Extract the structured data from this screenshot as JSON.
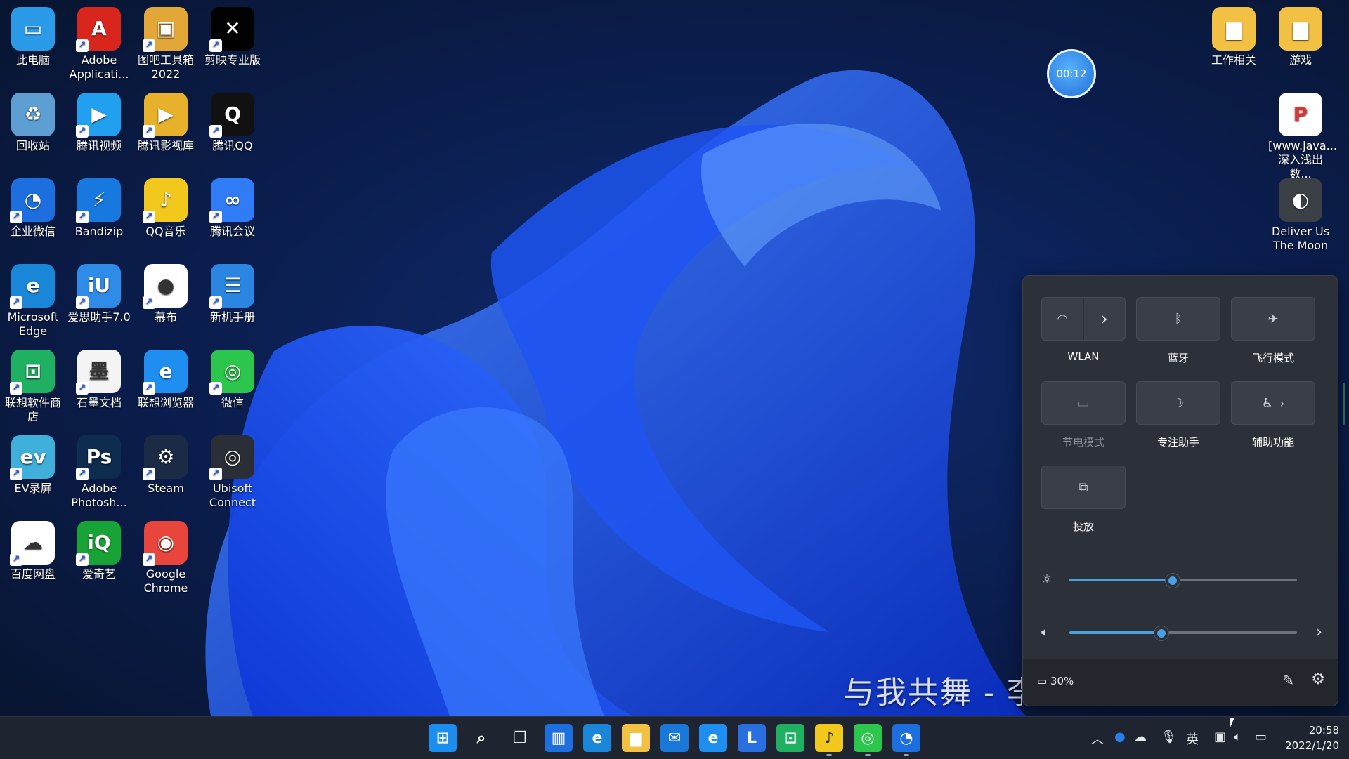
{
  "desktop": {
    "icons": [
      {
        "label": "此电脑",
        "icon": "computer-icon",
        "color": "#2b9be8",
        "glyph": "▭"
      },
      {
        "label": "Adobe Applicati...",
        "icon": "adobe-icon",
        "color": "#d9261c",
        "glyph": "A"
      },
      {
        "label": "图吧工具箱 2022",
        "icon": "toolbox-icon",
        "color": "#e2a736",
        "glyph": "▣"
      },
      {
        "label": "剪映专业版",
        "icon": "capcut-icon",
        "color": "#000000",
        "glyph": "✕"
      },
      {
        "label": "回收站",
        "icon": "recycle-bin-icon",
        "color": "#5d9fd3",
        "glyph": "♻"
      },
      {
        "label": "腾讯视频",
        "icon": "tencent-video-icon",
        "color": "#21a0f0",
        "glyph": "▶"
      },
      {
        "label": "腾讯影视库",
        "icon": "video-library-icon",
        "color": "#e7b12b",
        "glyph": "▶"
      },
      {
        "label": "腾讯QQ",
        "icon": "qq-icon",
        "color": "#111111",
        "glyph": "Q"
      },
      {
        "label": "企业微信",
        "icon": "wecom-icon",
        "color": "#1d6fe0",
        "glyph": "◔"
      },
      {
        "label": "Bandizip",
        "icon": "bandizip-icon",
        "color": "#1779e0",
        "glyph": "⚡"
      },
      {
        "label": "QQ音乐",
        "icon": "qq-music-icon",
        "color": "#f2c81d",
        "glyph": "♪"
      },
      {
        "label": "腾讯会议",
        "icon": "tencent-meeting-icon",
        "color": "#2f7cf6",
        "glyph": "∞"
      },
      {
        "label": "Microsoft Edge",
        "icon": "edge-icon",
        "color": "#1a86d8",
        "glyph": "e"
      },
      {
        "label": "爱思助手7.0",
        "icon": "i4-icon",
        "color": "#2e8be8",
        "glyph": "iU"
      },
      {
        "label": "幕布",
        "icon": "mubu-icon",
        "color": "#ffffff",
        "glyph": "●"
      },
      {
        "label": "新机手册",
        "icon": "manual-icon",
        "color": "#2a86e0",
        "glyph": "☰"
      },
      {
        "label": "联想软件商店",
        "icon": "lenovo-store-icon",
        "color": "#20b062",
        "glyph": "⊡"
      },
      {
        "label": "石墨文档",
        "icon": "shimo-icon",
        "color": "#f4f4f4",
        "glyph": "墨"
      },
      {
        "label": "联想浏览器",
        "icon": "lenovo-browser-icon",
        "color": "#1e8ff0",
        "glyph": "e"
      },
      {
        "label": "微信",
        "icon": "wechat-icon",
        "color": "#2cc64d",
        "glyph": "◎"
      },
      {
        "label": "EV录屏",
        "icon": "ev-recorder-icon",
        "color": "#3fb0d9",
        "glyph": "ev"
      },
      {
        "label": "Adobe Photosh...",
        "icon": "photoshop-icon",
        "color": "#0d2c4f",
        "glyph": "Ps"
      },
      {
        "label": "Steam",
        "icon": "steam-icon",
        "color": "#1b2b45",
        "glyph": "⚙"
      },
      {
        "label": "Ubisoft Connect",
        "icon": "ubisoft-icon",
        "color": "#2a2e36",
        "glyph": "◎"
      },
      {
        "label": "百度网盘",
        "icon": "baidu-netdisk-icon",
        "color": "#ffffff",
        "glyph": "☁"
      },
      {
        "label": "爱奇艺",
        "icon": "iqiyi-icon",
        "color": "#18a336",
        "glyph": "iQ"
      },
      {
        "label": "Google Chrome",
        "icon": "chrome-icon",
        "color": "#e8453c",
        "glyph": "◉"
      }
    ],
    "right_icons": [
      {
        "label": "工作相关",
        "icon": "folder-icon",
        "color": "#f2c144",
        "glyph": "▆"
      },
      {
        "label": "游戏",
        "icon": "folder-icon",
        "color": "#f2c144",
        "glyph": "▆"
      },
      {
        "label": "[www.java... 深入浅出数...",
        "icon": "pdf-icon",
        "color": "#ffffff",
        "glyph": "P"
      },
      {
        "label": "Deliver Us The Moon",
        "icon": "game-icon",
        "color": "#3b3f46",
        "glyph": "◐"
      }
    ],
    "timer": "00:12",
    "lyrics": "与我共舞 - 李"
  },
  "quick_settings": {
    "tiles": [
      {
        "label": "WLAN",
        "icon": "wifi-icon",
        "glyph": "◠",
        "dim": false,
        "split": true
      },
      {
        "label": "蓝牙",
        "icon": "bluetooth-icon",
        "glyph": "ᛒ",
        "dim": false
      },
      {
        "label": "飞行模式",
        "icon": "airplane-icon",
        "glyph": "✈",
        "dim": false
      },
      {
        "label": "节电模式",
        "icon": "battery-saver-icon",
        "glyph": "▭",
        "dim": true
      },
      {
        "label": "专注助手",
        "icon": "moon-icon",
        "glyph": "☽",
        "dim": false
      },
      {
        "label": "辅助功能",
        "icon": "accessibility-icon",
        "glyph": "♿",
        "dim": false,
        "arrow": true
      },
      {
        "label": "投放",
        "icon": "cast-icon",
        "glyph": "⧉",
        "dim": false
      }
    ],
    "brightness": 0.45,
    "volume": 0.4,
    "battery": "30%"
  },
  "taskbar": {
    "apps": [
      {
        "icon": "start-icon",
        "color": "#1b8ff0",
        "glyph": "⊞"
      },
      {
        "icon": "search-icon",
        "color": "transparent",
        "glyph": "⌕"
      },
      {
        "icon": "task-view-icon",
        "color": "transparent",
        "glyph": "❐"
      },
      {
        "icon": "widgets-icon",
        "color": "#1d6fe0",
        "glyph": "▥"
      },
      {
        "icon": "edge-icon",
        "color": "#1a86d8",
        "glyph": "e"
      },
      {
        "icon": "file-explorer-icon",
        "color": "#f2c144",
        "glyph": "▆"
      },
      {
        "icon": "mail-icon",
        "color": "#1a78d8",
        "glyph": "✉"
      },
      {
        "icon": "lenovo-browser-icon",
        "color": "#1e8ff0",
        "glyph": "e"
      },
      {
        "icon": "lenovo-l-icon",
        "color": "#2a6fe0",
        "glyph": "L"
      },
      {
        "icon": "lenovo-store-icon",
        "color": "#20b062",
        "glyph": "⊡"
      },
      {
        "icon": "qq-music-icon",
        "color": "#f2c81d",
        "glyph": "♪"
      },
      {
        "icon": "wechat-icon",
        "color": "#2cc64d",
        "glyph": "◎"
      },
      {
        "icon": "wecom-icon",
        "color": "#1d6fe0",
        "glyph": "◔"
      }
    ],
    "tray": {
      "chevron": "︿",
      "input_lang": "英",
      "time": "20:58",
      "date": "2022/1/20"
    }
  }
}
